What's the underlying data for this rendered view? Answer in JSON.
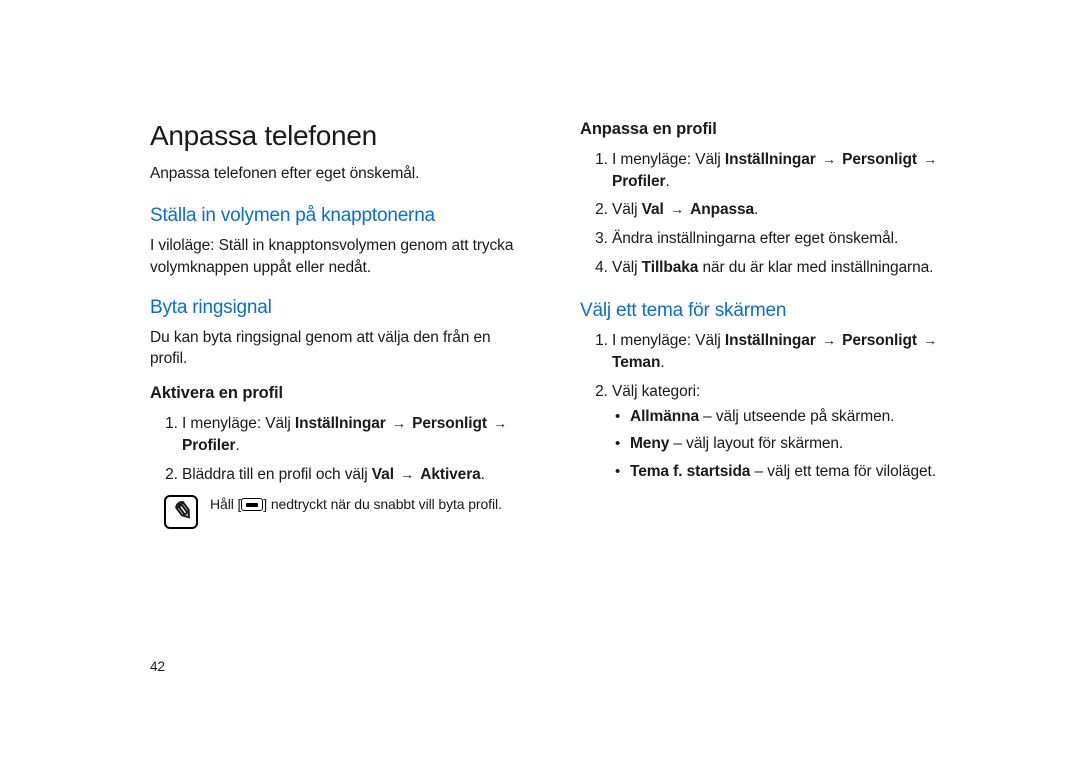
{
  "page_number": "42",
  "left": {
    "h1": "Anpassa telefonen",
    "caption": "Anpassa telefonen efter eget önskemål.",
    "s1_h": "Ställa in volymen på knapptonerna",
    "s1_b": "I viloläge: Ställ in knapptonsvolymen genom att trycka volymknappen uppåt eller nedåt.",
    "s2_h": "Byta ringsignal",
    "s2_b": "Du kan byta ringsignal genom att välja den från en profil.",
    "s2_sub": "Aktivera en profil",
    "ol1_1a": "I menyläge: Välj ",
    "ol1_1b": "Inställningar",
    "ol1_1c": "Personligt",
    "ol1_1d": "Profiler",
    "ol1_2a": "Bläddra till en profil och välj ",
    "ol1_2b": "Val",
    "ol1_2c": "Aktivera",
    "note_a": "Håll [",
    "note_b": "] nedtryckt när du snabbt vill byta profil."
  },
  "right": {
    "s3_sub": "Anpassa en profil",
    "ol2_1a": "I menyläge: Välj ",
    "ol2_1b": "Inställningar",
    "ol2_1c": "Personligt",
    "ol2_1d": "Profiler",
    "ol2_2a": "Välj ",
    "ol2_2b": "Val",
    "ol2_2c": "Anpassa",
    "ol2_3": "Ändra inställningarna efter eget önskemål.",
    "ol2_4a": "Välj ",
    "ol2_4b": "Tillbaka",
    "ol2_4c": " när du är klar med inställningarna.",
    "s4_h": "Välj ett tema för skärmen",
    "ol3_1a": "I menyläge: Välj ",
    "ol3_1b": "Inställningar",
    "ol3_1c": "Personligt",
    "ol3_1d": "Teman",
    "ol3_2": "Välj kategori:",
    "bul_1a": "Allmänna",
    "bul_1b": " – välj utseende på skärmen.",
    "bul_2a": "Meny",
    "bul_2b": " – välj layout för skärmen.",
    "bul_3a": "Tema f. startsida",
    "bul_3b": " – välj ett tema för viloläget."
  }
}
